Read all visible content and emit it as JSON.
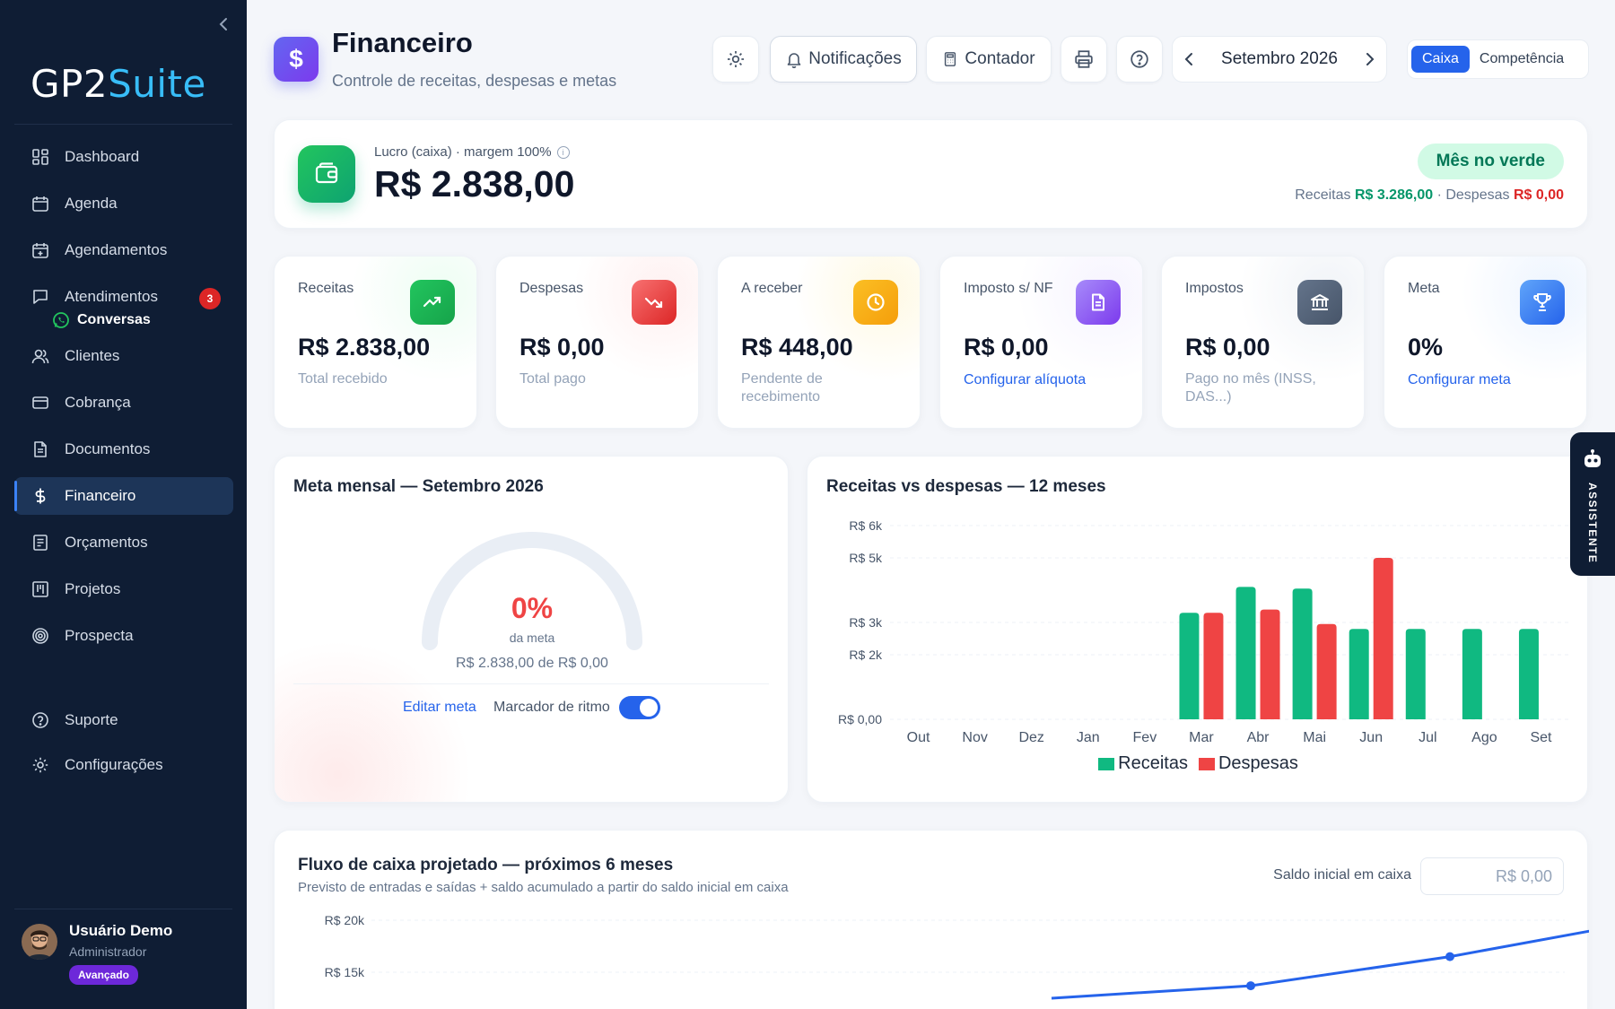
{
  "app": {
    "logo_part1": "GP2",
    "logo_part2": "Suite"
  },
  "sidebar": {
    "items": [
      {
        "label": "Dashboard",
        "icon": "grid-icon"
      },
      {
        "label": "Agenda",
        "icon": "calendar-icon"
      },
      {
        "label": "Agendamentos",
        "icon": "calendar-plus-icon"
      },
      {
        "label": "Atendimentos",
        "icon": "chat-icon",
        "badge": "3"
      },
      {
        "label": "Clientes",
        "icon": "users-icon"
      },
      {
        "label": "Cobrança",
        "icon": "credit-card-icon"
      },
      {
        "label": "Documentos",
        "icon": "document-icon"
      },
      {
        "label": "Financeiro",
        "icon": "dollar-icon",
        "active": true
      },
      {
        "label": "Orçamentos",
        "icon": "file-list-icon"
      },
      {
        "label": "Projetos",
        "icon": "kanban-icon"
      },
      {
        "label": "Prospecta",
        "icon": "target-icon"
      }
    ],
    "sub_item": {
      "label": "Conversas",
      "icon": "whatsapp-icon"
    },
    "bottom_items": [
      {
        "label": "Suporte",
        "icon": "help-circle-icon"
      },
      {
        "label": "Configurações",
        "icon": "gear-icon"
      }
    ],
    "user": {
      "name": "Usuário Demo",
      "role": "Administrador",
      "plan": "Avançado"
    }
  },
  "header": {
    "title": "Financeiro",
    "subtitle": "Controle de receitas, despesas e metas",
    "notifications_label": "Notificações",
    "contador_label": "Contador",
    "period": "Setembro 2026",
    "mode_active": "Caixa",
    "mode_other": "Competência"
  },
  "profit": {
    "label": "Lucro (caixa) · margem 100%",
    "value": "R$ 2.838,00",
    "status": "Mês no verde",
    "receitas_label": "Receitas",
    "receitas_value": "R$ 3.286,00",
    "separator": " · ",
    "despesas_label": "Despesas",
    "despesas_value": "R$ 0,00"
  },
  "kpis": [
    {
      "label": "Receitas",
      "value": "R$ 2.838,00",
      "sub": "Total recebido",
      "icon": "trending-up-icon",
      "color": "#16a34a"
    },
    {
      "label": "Despesas",
      "value": "R$ 0,00",
      "sub": "Total pago",
      "icon": "trending-down-icon",
      "color": "#dc2626"
    },
    {
      "label": "A receber",
      "value": "R$ 448,00",
      "sub": "Pendente de recebimento",
      "icon": "clock-icon",
      "color": "#f59e0b"
    },
    {
      "label": "Imposto s/ NF",
      "value": "R$ 0,00",
      "link": "Configurar alíquota",
      "icon": "document-icon",
      "color": "#8b5cf6"
    },
    {
      "label": "Impostos",
      "value": "R$ 0,00",
      "sub": "Pago no mês (INSS, DAS...)",
      "icon": "bank-icon",
      "color": "#64748b"
    },
    {
      "label": "Meta",
      "value": "0%",
      "link": "Configurar meta",
      "icon": "trophy-icon",
      "color": "#3b82f6"
    }
  ],
  "goal": {
    "title": "Meta mensal — Setembro 2026",
    "percent": "0%",
    "percent_value": 0,
    "percent_sub": "da meta",
    "progress_text": "R$ 2.838,00 de R$ 0,00",
    "edit_label": "Editar meta",
    "pace_label": "Marcador de ritmo",
    "pace_enabled": true
  },
  "chart_data": [
    {
      "type": "bar",
      "title": "Receitas vs despesas — 12 meses",
      "categories": [
        "Out",
        "Nov",
        "Dez",
        "Jan",
        "Fev",
        "Mar",
        "Abr",
        "Mai",
        "Jun",
        "Jul",
        "Ago",
        "Set"
      ],
      "y_ticks": [
        0,
        2000,
        3000,
        5000,
        6000
      ],
      "y_tick_labels": [
        "R$ 0,00",
        "R$ 2k",
        "R$ 3k",
        "R$ 5k",
        "R$ 6k"
      ],
      "ylim": [
        0,
        6000
      ],
      "series": [
        {
          "name": "Receitas",
          "color": "#10b981",
          "values": [
            0,
            0,
            0,
            0,
            0,
            3300,
            4100,
            4050,
            2800,
            2800,
            2800,
            2800
          ]
        },
        {
          "name": "Despesas",
          "color": "#ef4444",
          "values": [
            0,
            0,
            0,
            0,
            0,
            3300,
            3400,
            2950,
            5000,
            0,
            0,
            0
          ]
        }
      ],
      "legend": "bottom",
      "grid": true
    },
    {
      "type": "line",
      "title": "Fluxo de caixa projetado — próximos 6 meses",
      "subtitle": "Previsto de entradas e saídas + saldo acumulado a partir do saldo inicial em caixa",
      "y_ticks": [
        15000,
        20000
      ],
      "y_tick_labels": [
        "R$ 15k",
        "R$ 20k"
      ],
      "series": [
        {
          "name": "",
          "color": "#2563eb",
          "values": [
            null,
            null,
            12500,
            13700,
            16500,
            20000
          ]
        }
      ],
      "initial_balance_label": "Saldo inicial em caixa",
      "initial_balance_placeholder": "R$ 0,00"
    }
  ],
  "assistant": {
    "label": "ASSISTENTE"
  }
}
